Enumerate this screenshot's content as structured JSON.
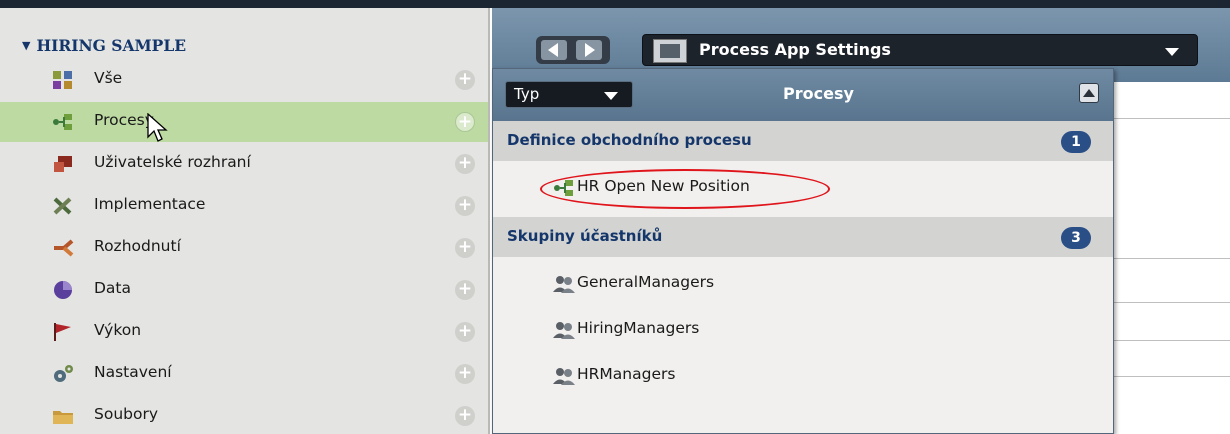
{
  "sidebar": {
    "header": "HIRING SAMPLE",
    "items": [
      {
        "label": "Vše",
        "icon": "grid-icon"
      },
      {
        "label": "Procesy",
        "icon": "process-icon",
        "selected": true
      },
      {
        "label": "Uživatelské rozhraní",
        "icon": "user-interface-icon"
      },
      {
        "label": "Implementace",
        "icon": "tools-icon"
      },
      {
        "label": "Rozhodnutí",
        "icon": "decision-icon"
      },
      {
        "label": "Data",
        "icon": "data-icon"
      },
      {
        "label": "Výkon",
        "icon": "flag-icon"
      },
      {
        "label": "Nastavení",
        "icon": "gears-icon"
      },
      {
        "label": "Soubory",
        "icon": "folder-icon"
      }
    ],
    "add_symbol": "+"
  },
  "editor": {
    "title": "Process App Settings"
  },
  "popup": {
    "type_label": "Typ",
    "title": "Procesy",
    "groups": [
      {
        "label": "Definice obchodního procesu",
        "count": "1",
        "items": [
          {
            "label": "HR Open New Position",
            "icon": "process-icon"
          }
        ]
      },
      {
        "label": "Skupiny účastníků",
        "count": "3",
        "items": [
          {
            "label": "GeneralManagers",
            "icon": "participants-icon"
          },
          {
            "label": "HiringManagers",
            "icon": "participants-icon"
          },
          {
            "label": "HRManagers",
            "icon": "participants-icon"
          }
        ]
      }
    ]
  },
  "colors": {
    "selected_row": "#bcdaa1",
    "header_text": "#14366b",
    "count_badge": "#2a4f86",
    "highlight": "#e0141b"
  }
}
